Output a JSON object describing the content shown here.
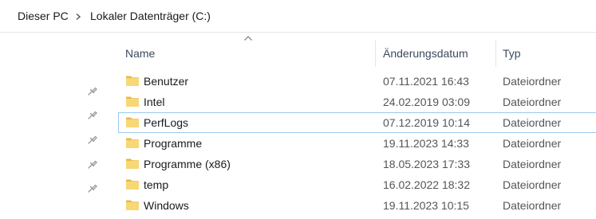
{
  "breadcrumb": {
    "items": [
      "Dieser PC",
      "Lokaler Datenträger (C:)"
    ]
  },
  "columns": {
    "name": "Name",
    "date": "Änderungsdatum",
    "type": "Typ"
  },
  "sort": {
    "column": "name",
    "direction": "ascending"
  },
  "files": [
    {
      "name": "Benutzer",
      "date": "07.11.2021 16:43",
      "type": "Dateiordner",
      "pinned": true
    },
    {
      "name": "Intel",
      "date": "24.02.2019 03:09",
      "type": "Dateiordner",
      "pinned": true
    },
    {
      "name": "PerfLogs",
      "date": "07.12.2019 10:14",
      "type": "Dateiordner",
      "pinned": true,
      "selected": true
    },
    {
      "name": "Programme",
      "date": "19.11.2023 14:33",
      "type": "Dateiordner",
      "pinned": true
    },
    {
      "name": "Programme (x86)",
      "date": "18.05.2023 17:33",
      "type": "Dateiordner",
      "pinned": true
    },
    {
      "name": "temp",
      "date": "16.02.2022 18:32",
      "type": "Dateiordner",
      "pinned": false
    },
    {
      "name": "Windows",
      "date": "19.11.2023 10:15",
      "type": "Dateiordner",
      "pinned": false
    }
  ],
  "colors": {
    "folder": "#f8d775",
    "folder_dark": "#e8b84a",
    "selection_border": "#99c9ef",
    "pin": "#9a9a9a"
  },
  "icons": {
    "pin": "pin-icon",
    "folder": "folder-icon",
    "separator": "chevron-right-icon",
    "sort": "sort-ascending-icon"
  }
}
